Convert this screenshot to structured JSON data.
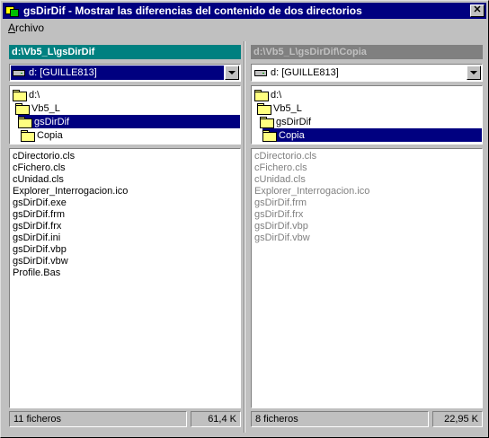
{
  "window": {
    "title": "gsDirDif - Mostrar las diferencias del contenido de dos directorios",
    "close_glyph": "✕"
  },
  "menu": {
    "archivo_accel": "A",
    "archivo_rest": "rchivo"
  },
  "left": {
    "path": "d:\\Vb5_L\\gsDirDif",
    "drive": "d: [GUILLE813]",
    "dirs": [
      "d:\\",
      "Vb5_L",
      "gsDirDif",
      "Copia"
    ],
    "files": [
      "cDirectorio.cls",
      "cFichero.cls",
      "cUnidad.cls",
      "Explorer_Interrogacion.ico",
      "gsDirDif.exe",
      "gsDirDif.frm",
      "gsDirDif.frx",
      "gsDirDif.ini",
      "gsDirDif.vbp",
      "gsDirDif.vbw",
      "Profile.Bas"
    ],
    "status_count": "11 ficheros",
    "status_size": "61,4 K"
  },
  "right": {
    "path": "d:\\Vb5_L\\gsDirDif\\Copia",
    "drive": "d: [GUILLE813]",
    "dirs": [
      "d:\\",
      "Vb5_L",
      "gsDirDif",
      "Copia"
    ],
    "files": [
      "cDirectorio.cls",
      "cFichero.cls",
      "cUnidad.cls",
      "Explorer_Interrogacion.ico",
      "gsDirDif.frm",
      "gsDirDif.frx",
      "gsDirDif.vbp",
      "gsDirDif.vbw"
    ],
    "status_count": "8 ficheros",
    "status_size": "22,95 K"
  }
}
